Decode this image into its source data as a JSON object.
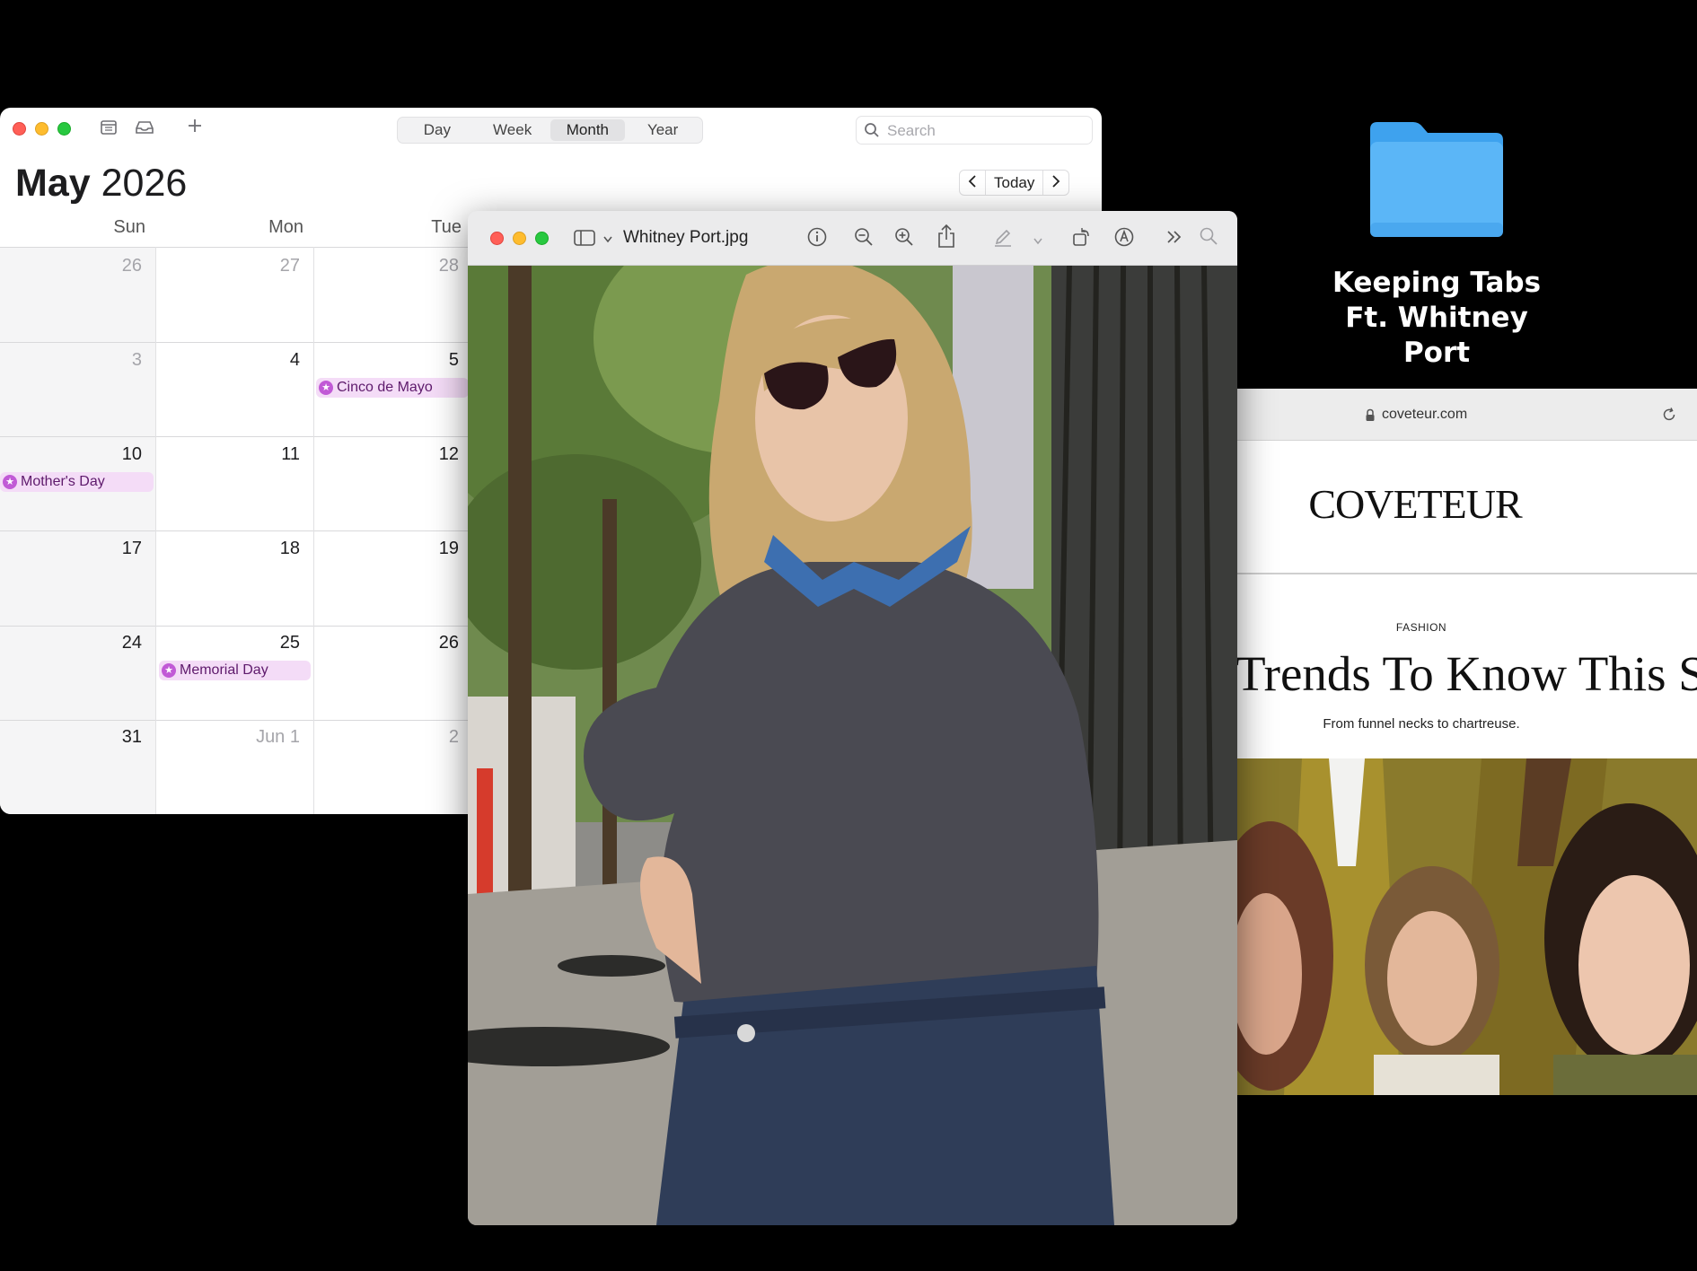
{
  "desktop": {
    "folder_label_line1": "Keeping Tabs",
    "folder_label_line2": "Ft. Whitney Port",
    "folder_color": "#5bb6f7"
  },
  "calendar": {
    "view_tabs": [
      {
        "label": "Day",
        "active": false
      },
      {
        "label": "Week",
        "active": false
      },
      {
        "label": "Month",
        "active": true
      },
      {
        "label": "Year",
        "active": false
      }
    ],
    "search_placeholder": "Search",
    "month": "May",
    "year": "2026",
    "today_label": "Today",
    "weekdays": [
      "Sun",
      "Mon",
      "Tue"
    ],
    "weeks": [
      [
        "26",
        "27",
        "28"
      ],
      [
        "3",
        "4",
        "5"
      ],
      [
        "10",
        "11",
        "12"
      ],
      [
        "17",
        "18",
        "19"
      ],
      [
        "24",
        "25",
        "26"
      ],
      [
        "31",
        "Jun 1",
        "2"
      ]
    ],
    "events": {
      "cinco": "Cinco de Mayo",
      "mothers": "Mother's Day",
      "memorial": "Memorial Day"
    },
    "event_color": "#c15ad6"
  },
  "preview": {
    "filename": "Whitney Port.jpg"
  },
  "safari": {
    "url": "coveteur.com",
    "logo": "COVETEUR",
    "kicker": "FASHION",
    "headline": "Trends To Know This Se",
    "dek": "From funnel necks to chartreuse."
  }
}
